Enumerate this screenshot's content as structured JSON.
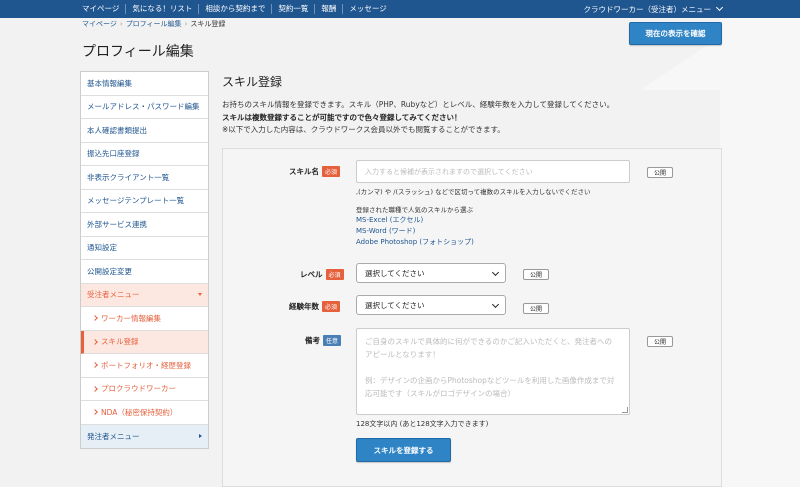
{
  "topnav": {
    "links": [
      "マイページ",
      "気になる！リスト",
      "相談から契約まで",
      "契約一覧",
      "報酬",
      "メッセージ"
    ],
    "user_menu": "クラウドワーカー（受注者）メニュー"
  },
  "breadcrumb": [
    "マイページ",
    "プロフィール編集",
    "スキル登録"
  ],
  "page_title": "プロフィール編集",
  "confirm_button": "現在の表示を確認",
  "sidebar": {
    "items": [
      "基本情報編集",
      "メールアドレス・パスワード編集",
      "本人確認書類提出",
      "振込先口座登録",
      "非表示クライアント一覧",
      "メッセージテンプレート一覧",
      "外部サービス連携",
      "通知設定",
      "公開設定変更"
    ],
    "worker_menu": "受注者メニュー",
    "worker_items": [
      "ワーカー情報編集",
      "スキル登録",
      "ポートフォリオ・経歴登録",
      "プロクラウドワーカー",
      "NDA（秘密保持契約）"
    ],
    "client_menu": "発注者メニュー"
  },
  "main": {
    "title": "スキル登録",
    "intro1": "お持ちのスキル情報を登録できます。スキル（PHP、Rubyなど）とレベル、経験年数を入力して登録してください。",
    "intro2": "スキルは複数登録することが可能ですので色々登録してみてください！",
    "intro3": "※以下で入力した内容は、クラウドワークス会員以外でも閲覧することができます。"
  },
  "form": {
    "required_badge": "必須",
    "optional_badge": "任意",
    "public_label": "公開",
    "skill_label": "スキル名",
    "skill_placeholder": "入力すると候補が表示されますので選択してください",
    "skill_hint": ",(カンマ) や /(スラッシュ) などで区切って複数のスキルを入力しないでください",
    "popular_hint": "登録された職種で人気のスキルから選ぶ",
    "popular_skills": [
      "MS-Excel (エクセル)",
      "MS-Word (ワード)",
      "Adobe Photoshop (フォトショップ)"
    ],
    "level_label": "レベル",
    "level_value": "選択してください",
    "years_label": "経験年数",
    "years_value": "選択してください",
    "notes_label": "備考",
    "notes_placeholder_1": "ご自身のスキルで具体的に何ができるのかご記入いただくと、発注者への",
    "notes_placeholder_2": "アピールとなります！",
    "notes_placeholder_3": "例：デザインの企画からPhotoshopなどツールを利用した画像作成まで対",
    "notes_placeholder_4": "応可能です（スキルがロゴデザインの場合）",
    "notes_counter": "128文字以内 (あと128文字入力できます)",
    "submit_label": "スキルを登録する"
  },
  "colors": {
    "nav_blue": "#1f5690",
    "button_blue": "#2f84c6",
    "accent_orange": "#e6603c"
  }
}
